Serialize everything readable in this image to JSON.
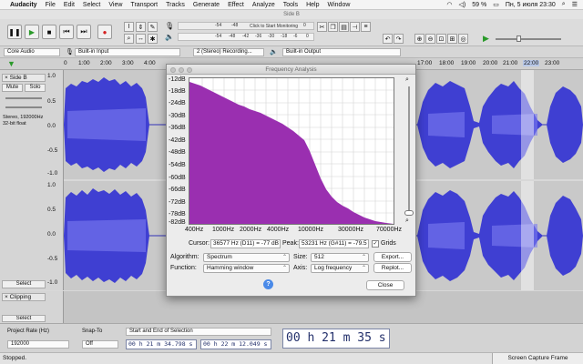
{
  "menubar": {
    "app": "Audacity",
    "items": [
      "File",
      "Edit",
      "Select",
      "View",
      "Transport",
      "Tracks",
      "Generate",
      "Effect",
      "Analyze",
      "Tools",
      "Help",
      "Window"
    ],
    "battery": "59 %",
    "clock": "Пн, 5 июля  23:30"
  },
  "window": {
    "title": "Side B"
  },
  "toolbar": {
    "meter_text": "Click to Start Monitoring",
    "meter_ticks": [
      "-54",
      "-48",
      "-42",
      "-18",
      "-12",
      "-6",
      "0"
    ],
    "playback_ticks": [
      "-54",
      "-48",
      "-42",
      "-36",
      "-30",
      "-24",
      "-18",
      "-12",
      "-6",
      "0"
    ]
  },
  "devices": {
    "host": "Core Audio",
    "input": "Built-in Input",
    "channels": "2 (Stereo) Recording...",
    "output": "Built-in Output"
  },
  "timeline": {
    "ticks": [
      "0",
      "1:00",
      "2:00",
      "3:00",
      "4:00",
      "17:00",
      "18:00",
      "19:00",
      "20:00",
      "21:00",
      "22:00",
      "23:00"
    ]
  },
  "tracks": [
    {
      "name": "Side B",
      "mute": "Mute",
      "solo": "Solo",
      "info": "Stereo, 192000Hz\n32-bit float",
      "select": "Select",
      "scale_top": [
        "1.0",
        "0.5",
        "0.0",
        "-0.5",
        "-1.0"
      ],
      "scale_bottom": [
        "1.0",
        "0.5",
        "0.0",
        "-0.5",
        "-1.0"
      ]
    },
    {
      "name": "Clipping",
      "select": "Select"
    }
  ],
  "dialog": {
    "title": "Frequency Analysis",
    "db_labels": [
      "-12dB",
      "-18dB",
      "-24dB",
      "-30dB",
      "-36dB",
      "-42dB",
      "-48dB",
      "-54dB",
      "-60dB",
      "-66dB",
      "-72dB",
      "-78dB",
      "-82dB"
    ],
    "hz_labels": [
      "400Hz",
      "1000Hz",
      "2000Hz",
      "4000Hz",
      "10000Hz",
      "30000Hz",
      "70000Hz"
    ],
    "cursor_label": "Cursor:",
    "cursor_value": "36577 Hz (D11) = -77 dB",
    "peak_label": "Peak:",
    "peak_value": "53231 Hz (G#11) = -79.5",
    "grids_label": "Grids",
    "algorithm_label": "Algorithm:",
    "algorithm_value": "Spectrum",
    "size_label": "Size:",
    "size_value": "512",
    "export_label": "Export...",
    "function_label": "Function:",
    "function_value": "Hamming window",
    "axis_label": "Axis:",
    "axis_value": "Log frequency",
    "replot_label": "Replot...",
    "help_label": "?",
    "close_label": "Close"
  },
  "bottom": {
    "rate_label": "Project Rate (Hz)",
    "rate_value": "192000",
    "snap_label": "Snap-To",
    "snap_value": "Off",
    "selection_mode": "Start and End of Selection",
    "sel_start": "00 h 21 m 34.798 s",
    "sel_end": "00 h 22 m 12.049 s",
    "big_time": "00 h 21 m 35 s"
  },
  "status": {
    "text": "Stopped.",
    "capture": "Screen Capture Frame"
  },
  "colors": {
    "wave": "#3f3fd2",
    "spectrum": "#9a2fb0",
    "accent": "#2d6ad6"
  }
}
